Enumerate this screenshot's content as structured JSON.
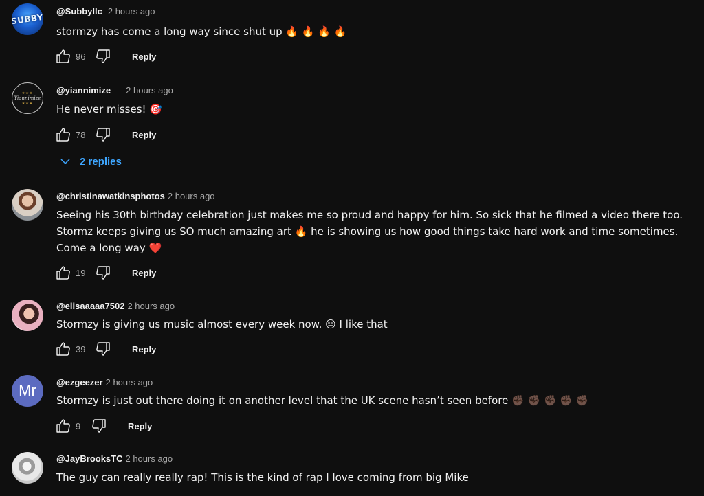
{
  "comments": [
    {
      "handle": "@Subbyllc",
      "time": "2 hours ago",
      "avatar_text": "SUBBY",
      "text": "stormzy has come a long way since shut up 🔥 🔥 🔥 🔥",
      "likes": "96",
      "reply_label": "Reply"
    },
    {
      "handle": "@yiannimize",
      "time": "2 hours ago",
      "avatar_text": "Yiannimize",
      "text": "He never misses! 🎯",
      "likes": "78",
      "reply_label": "Reply",
      "replies_label": "2 replies"
    },
    {
      "handle": "@christinawatkinsphotos",
      "time": "2 hours ago",
      "text_a": "Seeing his 30th birthday celebration just makes me so proud and happy for him. So sick that he filmed a video there too. Stormz keeps giving us SO much amazing art ",
      "emoji_a": "🔥",
      "text_b": "  he is showing us how good things take hard work and time sometimes. Come a long way ",
      "emoji_b": "❤️",
      "likes": "19",
      "reply_label": "Reply"
    },
    {
      "handle": "@elisaaaaa7502",
      "time": "2 hours ago",
      "text": "Stormzy is giving us music almost every week now. 😑  I like that",
      "likes": "39",
      "reply_label": "Reply"
    },
    {
      "handle": "@ezgeezer",
      "time": "2 hours ago",
      "avatar_text": "Mr",
      "text": "Stormzy is just out there doing it on another level that the UK scene hasn’t seen before ✊🏿 ✊🏿 ✊🏿 ✊🏿  ✊🏿",
      "likes": "9",
      "reply_label": "Reply"
    },
    {
      "handle": "@JayBrooksTC",
      "time": "2 hours ago",
      "text": "The guy can really really rap! This is the kind of rap I love coming from big Mike"
    }
  ],
  "icons": {
    "like": "thumbs-up-icon",
    "dislike": "thumbs-down-icon",
    "expand": "chevron-down-icon"
  },
  "colors": {
    "background": "#0f0f0f",
    "text": "#f1f1f1",
    "muted": "#aaaaaa",
    "link": "#3ea6ff",
    "avatar_ez": "#5c6bc0"
  }
}
